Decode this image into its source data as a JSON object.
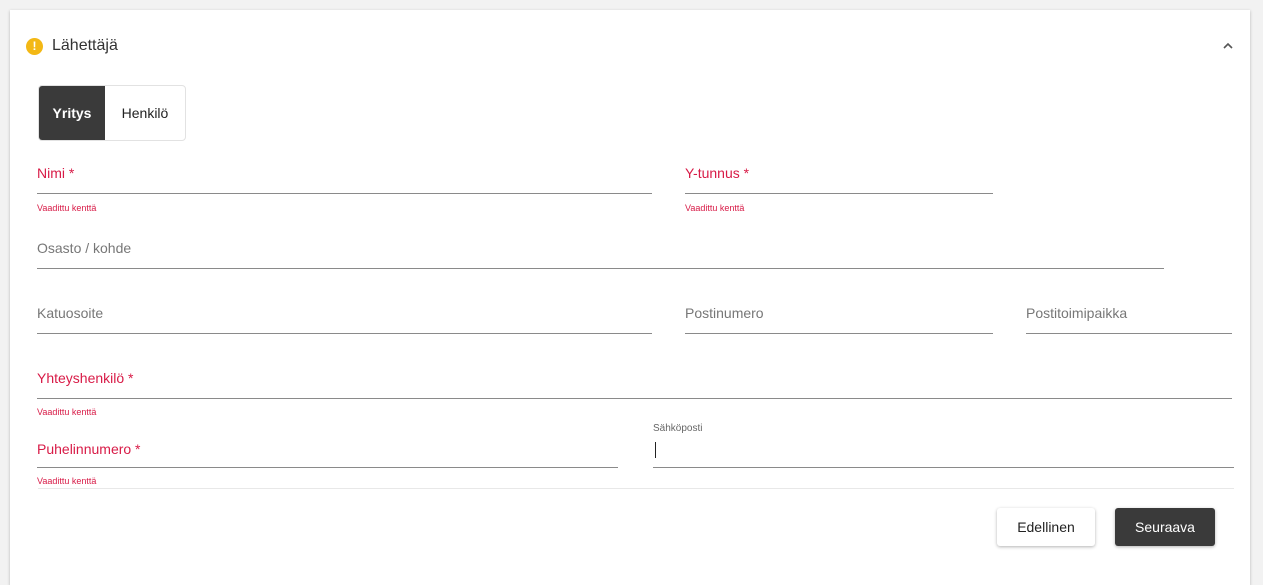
{
  "section": {
    "title": "Lähettäjä",
    "warning_icon": "exclamation-circle-icon",
    "collapse_icon": "chevron-up-icon"
  },
  "type_toggle": {
    "company": "Yritys",
    "person": "Henkilö",
    "selected": "Yritys"
  },
  "fields": {
    "name": {
      "label": "Nimi *",
      "error": "Vaadittu kenttä"
    },
    "business_id": {
      "label": "Y-tunnus *",
      "error": "Vaadittu kenttä"
    },
    "department": {
      "label": "Osasto / kohde"
    },
    "street": {
      "label": "Katuosoite"
    },
    "postal_code": {
      "label": "Postinumero"
    },
    "city": {
      "label": "Postitoimipaikka"
    },
    "contact_person": {
      "label": "Yhteyshenkilö *",
      "error": "Vaadittu kenttä"
    },
    "phone": {
      "label": "Puhelinnumero *",
      "error": "Vaadittu kenttä"
    },
    "email": {
      "label": "Sähköposti",
      "value": ""
    }
  },
  "buttons": {
    "previous": "Edellinen",
    "next": "Seuraava"
  },
  "colors": {
    "error": "#d81b47",
    "warning": "#f3b815",
    "dark": "#3a3a3a"
  }
}
